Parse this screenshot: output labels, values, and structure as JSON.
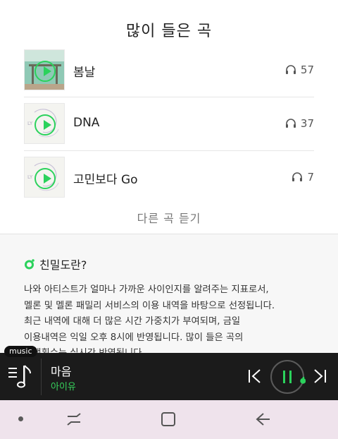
{
  "section": {
    "title": "많이 들은 곡"
  },
  "songs": [
    {
      "title": "봄날",
      "plays": "57",
      "thumb_bg": "#8fc9b5"
    },
    {
      "title": "DNA",
      "plays": "37",
      "thumb_bg": "#f4f4f0"
    },
    {
      "title": "고민보다 Go",
      "plays": "7",
      "thumb_bg": "#f4f4f0"
    }
  ],
  "more_button": "다른 곡 듣기",
  "info": {
    "title": "친밀도란?",
    "lines": [
      "나와 아티스트가 얼마나 가까운 사이인지를 알려주는 지표로서,",
      "멜론 및 멜론 패밀리 서비스의 이용 내역을 바탕으로 선정됩니다.",
      "최근 내역에 대해 더 많은 시간 가중치가 부여되며, 금일",
      "이용내역은 익일 오후 8시에 반영됩니다. 많이 들은 곡의",
      "재생횟수는 실시간 반영됩니다."
    ]
  },
  "player": {
    "tag": "music",
    "title": "마음",
    "artist": "아이유",
    "progress": 0.04
  },
  "colors": {
    "accent": "#2bd25c",
    "player_bg": "#1b1b1b",
    "nav_bg": "#efe3ec"
  },
  "icons": {
    "headphones": "headphones-icon",
    "playlist": "playlist-icon",
    "prev": "skip-previous-icon",
    "pause": "pause-icon",
    "next": "skip-next-icon"
  }
}
